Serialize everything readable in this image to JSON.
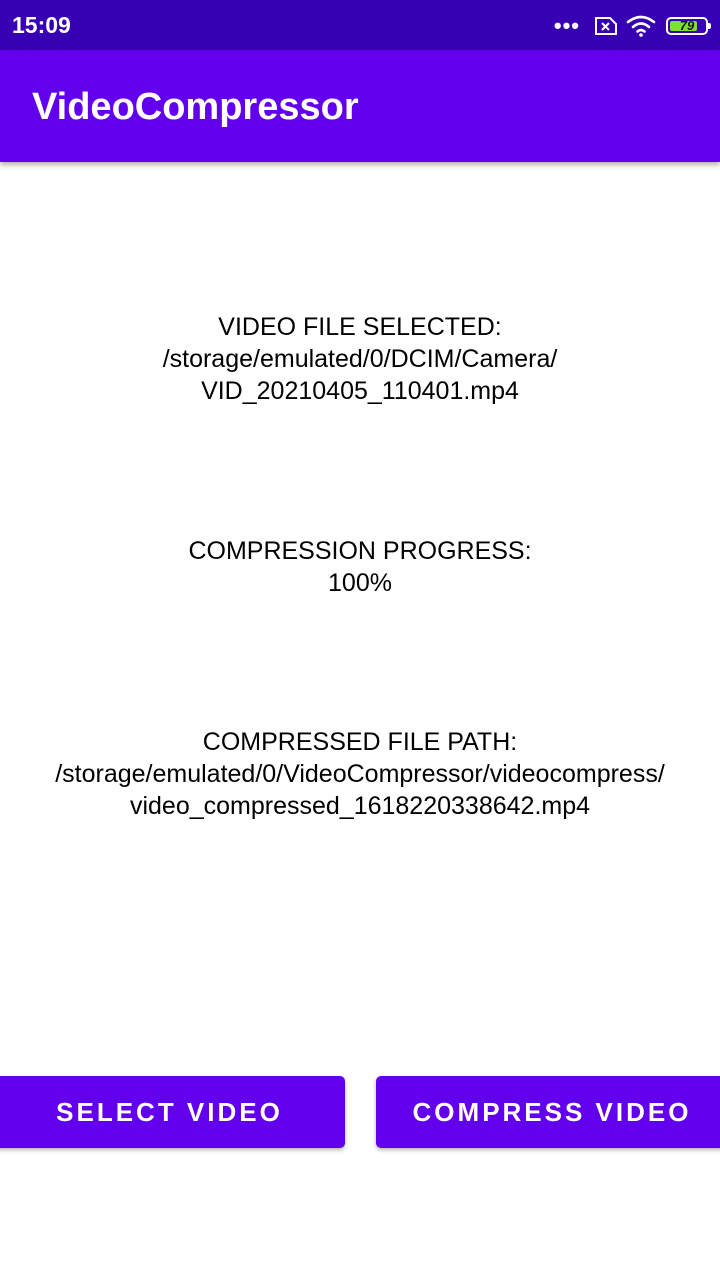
{
  "status_bar": {
    "time": "15:09",
    "dots": "•••",
    "battery_level": "79",
    "battery_fraction": 0.79,
    "icons": [
      "more-dots-icon",
      "sim-disabled-icon",
      "wifi-icon",
      "battery-icon"
    ]
  },
  "app_bar": {
    "title": "VideoCompressor"
  },
  "selected": {
    "label": "VIDEO FILE SELECTED:",
    "path_line1": "/storage/emulated/0/DCIM/Camera/",
    "path_line2": "VID_20210405_110401.mp4"
  },
  "progress": {
    "label": "COMPRESSION PROGRESS:",
    "value": "100%"
  },
  "compressed": {
    "label": "COMPRESSED FILE PATH:",
    "path_line1": "/storage/emulated/0/VideoCompressor/videocompress/",
    "path_line2": "video_compressed_1618220338642.mp4"
  },
  "buttons": {
    "select_label": "SELECT VIDEO",
    "compress_label": "COMPRESS VIDEO"
  },
  "colors": {
    "status_bar": "#3700b3",
    "primary": "#6200ee",
    "battery_fill": "#7ddf3a"
  }
}
